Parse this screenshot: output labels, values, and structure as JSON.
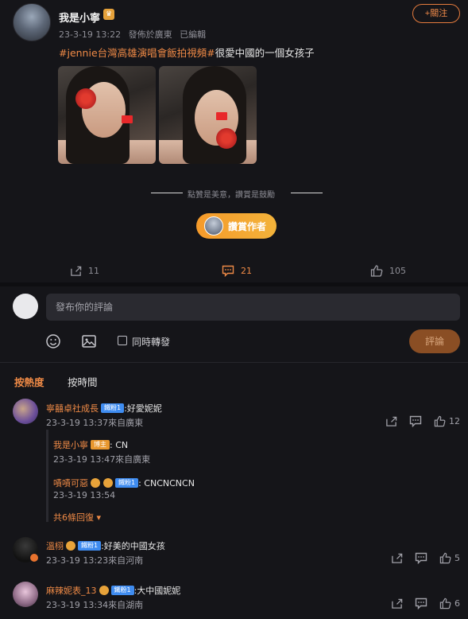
{
  "post": {
    "author": "我是小寧",
    "timestamp": "23-3-19 13:22",
    "location": "發佈於廣東",
    "edited": "已編輯",
    "follow_label": "+關注",
    "hashtag": "#jennie台灣高雄演唱會飯拍視頻#",
    "text": "很愛中國的一個女孩子",
    "slogan": "點贊是美意，讚賞是鼓勵",
    "reward_label": "讚賞作者",
    "shares": "11",
    "comments": "21",
    "likes": "105"
  },
  "composer": {
    "placeholder": "發布你的評論",
    "repost_label": "同時轉發",
    "submit_label": "評論"
  },
  "sort": {
    "hot": "按熱度",
    "time": "按時間"
  },
  "comments": [
    {
      "user": "寧囍卓社成長",
      "badge": "鐵粉1",
      "text": ":好愛妮妮",
      "meta": "23-3-19 13:37來自廣東",
      "likes": "12",
      "replies": [
        {
          "user": "我是小寧",
          "badge": "博主",
          "text": ": CN",
          "meta": "23-3-19 13:47來自廣東"
        },
        {
          "user": "嘖嘖可惡",
          "badge": "鐵粉1",
          "text": ": CNCNCNCN",
          "meta": "23-3-19 13:54"
        }
      ],
      "more": "共6條回復"
    },
    {
      "user": "溫栩",
      "badge": "鐵粉1",
      "text": ":好美的中國女孩",
      "meta": "23-3-19 13:23來自河南",
      "likes": "5"
    },
    {
      "user": "麻辣妮表_13",
      "badge": "鐵粉1",
      "text": ":大中國妮妮",
      "meta": "23-3-19 13:34來自湖南",
      "likes": "6"
    }
  ],
  "colors": {
    "accent": "#ef8a46",
    "background": "#151519",
    "input_bg": "#2a2a30"
  }
}
